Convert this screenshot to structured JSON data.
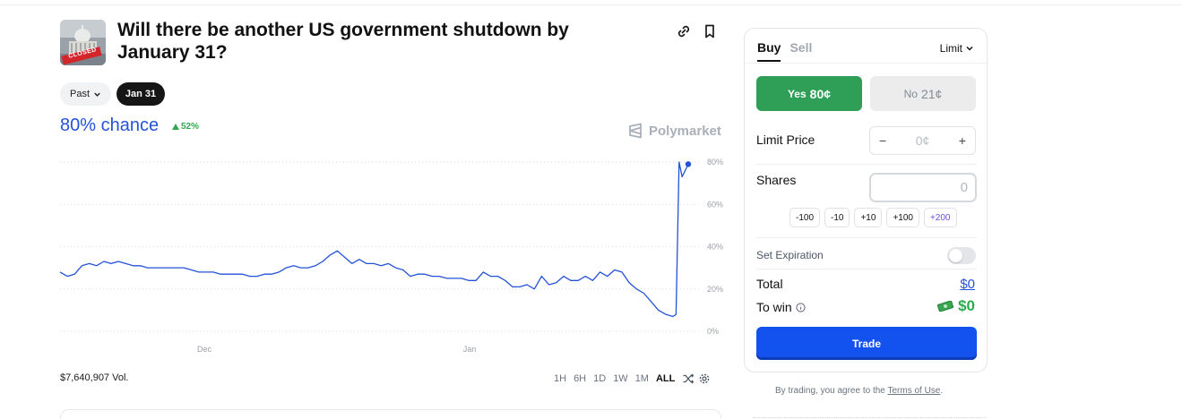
{
  "market": {
    "title": "Will there be another US government shutdown by January 31?",
    "thumbnail_badge": "CLOSED"
  },
  "date_filter": {
    "past_label": "Past",
    "active_label": "Jan 31"
  },
  "stats": {
    "chance": "80% chance",
    "delta": "52%"
  },
  "brand": {
    "name": "Polymarket"
  },
  "volume": "$7,640,907 Vol.",
  "ranges": [
    "1H",
    "6H",
    "1D",
    "1W",
    "1M",
    "ALL"
  ],
  "active_range": "ALL",
  "chart_data": {
    "type": "line",
    "title": "",
    "xlabel": "",
    "ylabel": "",
    "ylim": [
      0,
      80
    ],
    "y_ticks": [
      "80%",
      "60%",
      "40%",
      "20%",
      "0%"
    ],
    "x_ticks": [
      "Dec",
      "Jan"
    ],
    "line_color": "#2452d8",
    "grid": "dotted horizontal",
    "series": [
      {
        "values": [
          28,
          26,
          27,
          31,
          32,
          31,
          33,
          32,
          33,
          32,
          31,
          31,
          30,
          30,
          30,
          30,
          30,
          30,
          29,
          28,
          28,
          28,
          27,
          27,
          27,
          27,
          26,
          26,
          27,
          27,
          28,
          30,
          31,
          30,
          30,
          31,
          33,
          36,
          38,
          35,
          32,
          34,
          32,
          32,
          31,
          32,
          30,
          29,
          26,
          27,
          27,
          26,
          26,
          25,
          25,
          25,
          24,
          24,
          28,
          26,
          26,
          24,
          21,
          21,
          22,
          20,
          26,
          22,
          23,
          26,
          24,
          24,
          26,
          24,
          28,
          26,
          29,
          28,
          23,
          20,
          18,
          14,
          10,
          8,
          7,
          8,
          80,
          73,
          76,
          79
        ]
      }
    ]
  },
  "trade_panel": {
    "tab_buy": "Buy",
    "tab_sell": "Sell",
    "order_type": "Limit",
    "yes_label": "Yes",
    "yes_price": "80¢",
    "no_label": "No",
    "no_price": "21¢",
    "limit_price_label": "Limit Price",
    "limit_minus": "−",
    "limit_value": "0¢",
    "limit_plus": "+",
    "shares_label": "Shares",
    "shares_value": "0",
    "chips": [
      "-100",
      "-10",
      "+10",
      "+100",
      "+200"
    ],
    "expiration_label": "Set Expiration",
    "total_label": "Total",
    "total_value": "$0",
    "to_win_label": "To win",
    "to_win_value": "$0",
    "trade_button": "Trade"
  },
  "terms": {
    "prefix": "By trading, you agree to the ",
    "link": "Terms of Use",
    "suffix": "."
  },
  "colors": {
    "accent_blue": "#2452d8",
    "yes_green": "#2f9f57",
    "trade_blue": "#1452f0"
  }
}
